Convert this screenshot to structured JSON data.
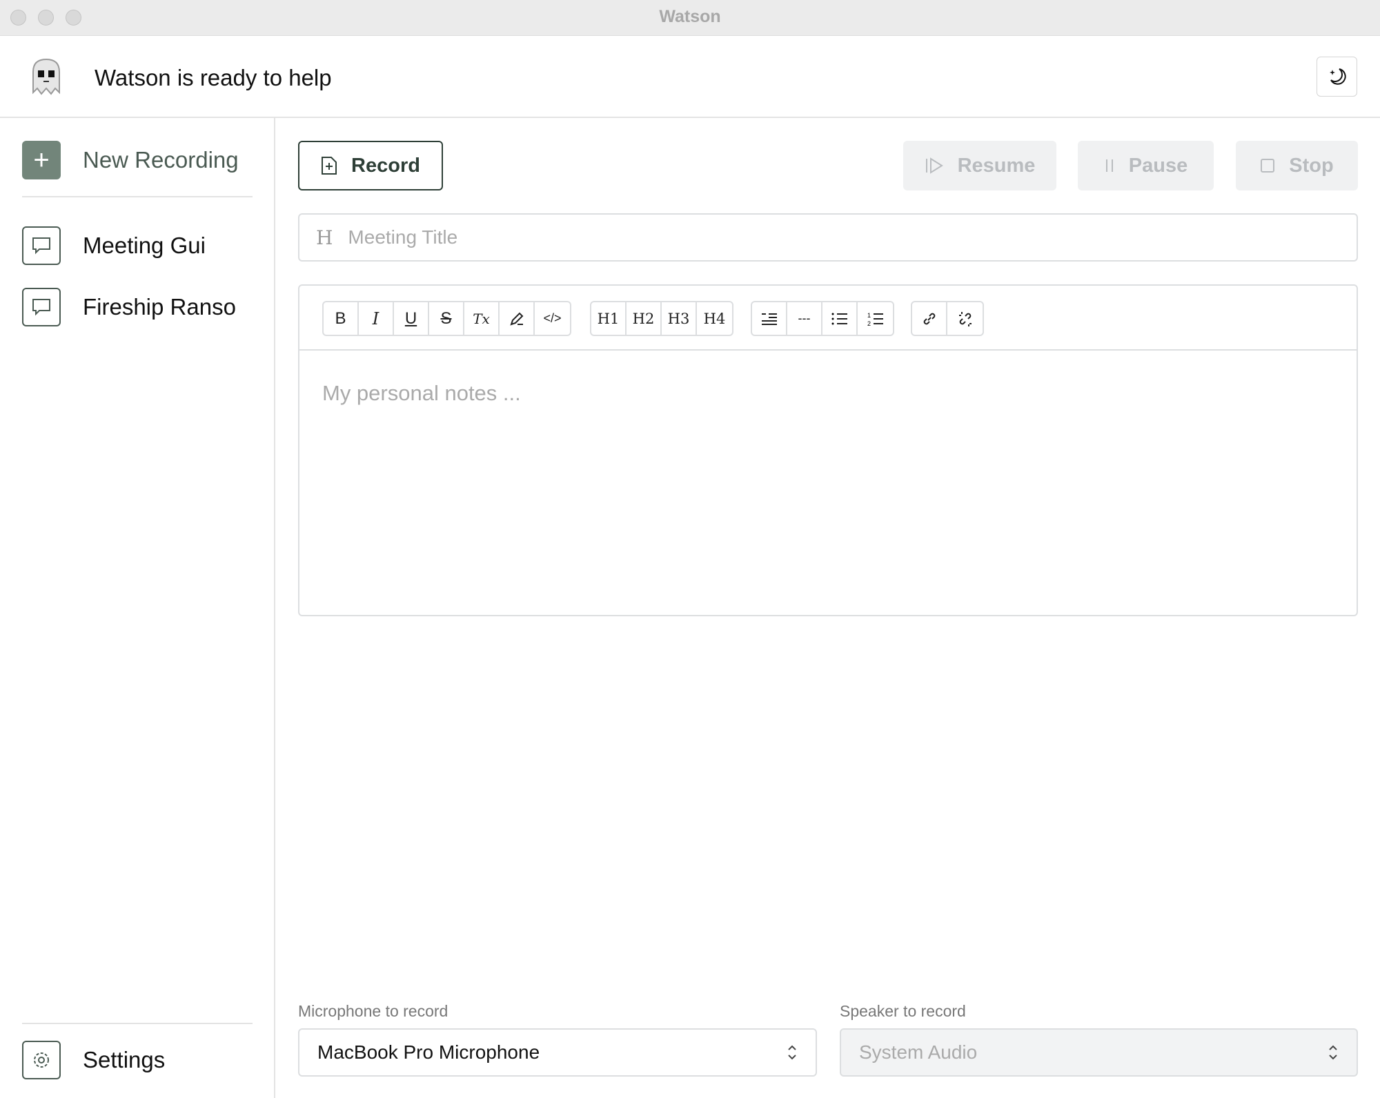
{
  "window": {
    "title": "Watson"
  },
  "header": {
    "status": "Watson is ready to help"
  },
  "sidebar": {
    "new_recording": "New Recording",
    "items": [
      {
        "label": "Meeting Gui"
      },
      {
        "label": "Fireship Ranso"
      }
    ],
    "settings": "Settings"
  },
  "controls": {
    "record": "Record",
    "resume": "Resume",
    "pause": "Pause",
    "stop": "Stop"
  },
  "title_input": {
    "placeholder": "Meeting Title",
    "prefix": "H"
  },
  "editor": {
    "placeholder": "My personal notes ...",
    "toolbar": {
      "bold": "B",
      "italic": "I",
      "underline": "U",
      "strike": "S",
      "clear": "Tx",
      "h1": "H1",
      "h2": "H2",
      "h3": "H3",
      "h4": "H4",
      "hr": "---"
    }
  },
  "audio": {
    "mic_label": "Microphone to record",
    "mic_value": "MacBook Pro Microphone",
    "speaker_label": "Speaker to record",
    "speaker_value": "System Audio"
  },
  "colors": {
    "accent": "#2e3f37",
    "new_button": "#72857a"
  }
}
